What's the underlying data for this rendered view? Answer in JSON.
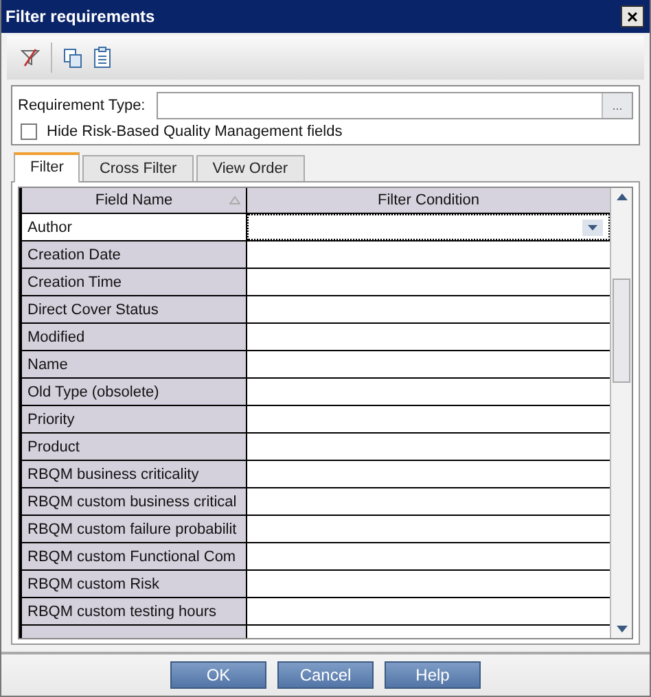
{
  "window": {
    "title": "Filter requirements",
    "close": "×"
  },
  "requirement_type": {
    "label": "Requirement Type:",
    "browse": "..."
  },
  "hide_rbqm": {
    "label": "Hide Risk-Based Quality Management fields",
    "checked": false
  },
  "tabs": [
    {
      "label": "Filter",
      "selected": true
    },
    {
      "label": "Cross Filter",
      "selected": false
    },
    {
      "label": "View Order",
      "selected": false
    }
  ],
  "table": {
    "columns": [
      "Field Name",
      "Filter Condition"
    ],
    "rows": [
      {
        "field": "Author",
        "selected": true
      },
      {
        "field": "Creation Date",
        "selected": false
      },
      {
        "field": "Creation Time",
        "selected": false
      },
      {
        "field": "Direct Cover Status",
        "selected": false
      },
      {
        "field": "Modified",
        "selected": false
      },
      {
        "field": "Name",
        "selected": false
      },
      {
        "field": "Old Type (obsolete)",
        "selected": false
      },
      {
        "field": "Priority",
        "selected": false
      },
      {
        "field": "Product",
        "selected": false
      },
      {
        "field": "RBQM business criticality",
        "selected": false
      },
      {
        "field": "RBQM custom business critical",
        "selected": false
      },
      {
        "field": "RBQM custom failure probabilit",
        "selected": false
      },
      {
        "field": "RBQM custom Functional Com",
        "selected": false
      },
      {
        "field": "RBQM custom Risk",
        "selected": false
      },
      {
        "field": "RBQM custom testing hours",
        "selected": false
      }
    ]
  },
  "buttons": [
    "OK",
    "Cancel",
    "Help"
  ]
}
